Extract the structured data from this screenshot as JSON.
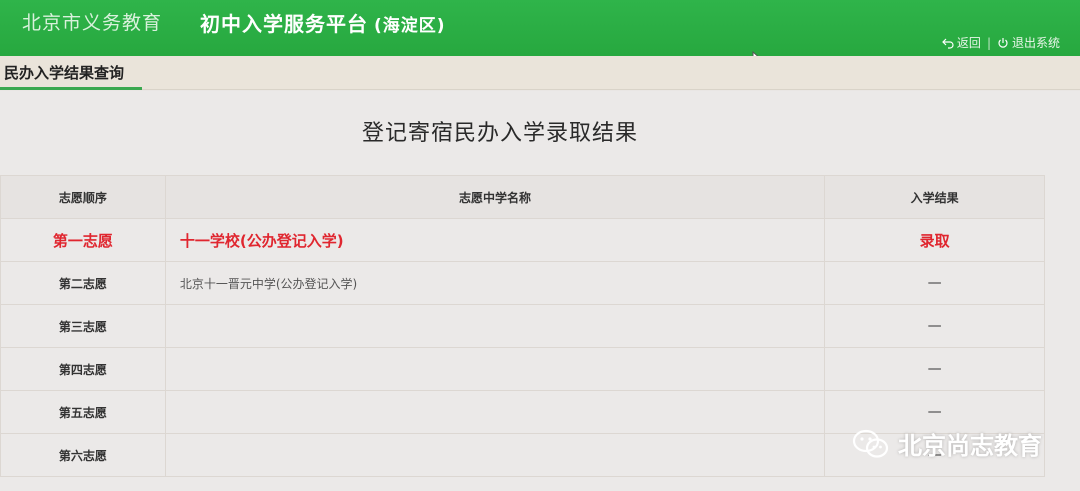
{
  "header": {
    "site_name": "北京市义务教育",
    "platform_title": "初中入学服务平台",
    "district": "(海淀区)",
    "back_label": "返回",
    "separator": "|",
    "logout_label": "退出系统"
  },
  "section": {
    "tab_label": "民办入学结果查询"
  },
  "main": {
    "title": "登记寄宿民办入学录取结果",
    "table": {
      "headers": [
        "志愿顺序",
        "志愿中学名称",
        "入学结果"
      ],
      "rows": [
        {
          "order": "第一志愿",
          "school": "十一学校(公办登记入学)",
          "result": "录取"
        },
        {
          "order": "第二志愿",
          "school": "北京十一晋元中学(公办登记入学)",
          "result": "—"
        },
        {
          "order": "第三志愿",
          "school": "",
          "result": "—"
        },
        {
          "order": "第四志愿",
          "school": "",
          "result": "—"
        },
        {
          "order": "第五志愿",
          "school": "",
          "result": "—"
        },
        {
          "order": "第六志愿",
          "school": "",
          "result": "—"
        }
      ]
    }
  },
  "watermark": {
    "text": "北京尚志教育",
    "icon": "wechat-icon"
  },
  "colors": {
    "header_green": "#2fb44a",
    "accent_red": "#e0262f",
    "tab_underline": "#3aa84f"
  }
}
